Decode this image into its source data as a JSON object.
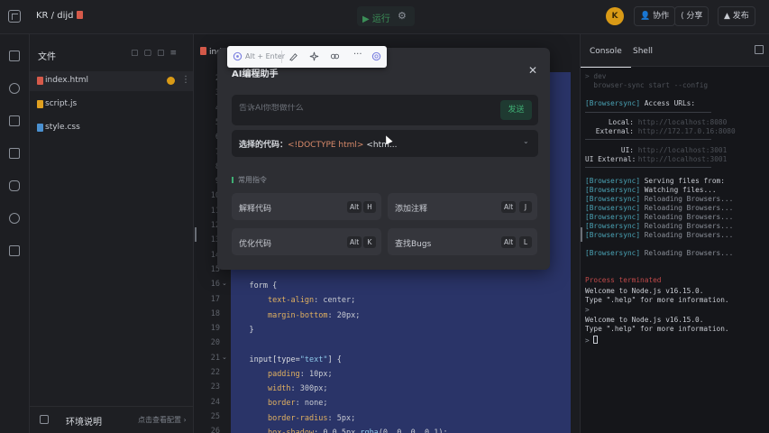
{
  "topbar": {
    "breadcrumb": "KR / dijd",
    "run_label": "▶ 运行",
    "avatar_initial": "K",
    "collab_label": "协作",
    "share_label": "分享",
    "publish_label": "发布"
  },
  "files": {
    "title": "文件",
    "items": [
      {
        "name": "index.html",
        "color": "#d65a4a"
      },
      {
        "name": "script.js",
        "color": "#e0a020"
      },
      {
        "name": "style.css",
        "color": "#4a90d0"
      }
    ],
    "footer_label": "环境说明",
    "footer_hint": "点击查看配置"
  },
  "editor": {
    "tab_label": "index.html",
    "line_numbers": [
      "2",
      "3",
      "4",
      "5",
      "6",
      "7",
      "8",
      "9",
      "10",
      "11",
      "12",
      "13",
      "14",
      "15",
      "16",
      "17",
      "18",
      "19",
      "20",
      "21",
      "22",
      "23",
      "24",
      "25",
      "26"
    ],
    "code_lines": [
      {
        "indent": "    ",
        "parts": [
          {
            "t": "form {",
            "c": "t-sel"
          }
        ]
      },
      {
        "indent": "        ",
        "parts": [
          {
            "t": "text-align",
            "c": "t-prop"
          },
          {
            "t": ": center;",
            "c": "t-fn"
          }
        ]
      },
      {
        "indent": "        ",
        "parts": [
          {
            "t": "margin-bottom",
            "c": "t-prop"
          },
          {
            "t": ": 20px;",
            "c": "t-fn"
          }
        ]
      },
      {
        "indent": "    ",
        "parts": [
          {
            "t": "}",
            "c": "t-sel"
          }
        ]
      },
      {
        "indent": "",
        "parts": [
          {
            "t": "",
            "c": "t-sel"
          }
        ]
      },
      {
        "indent": "    ",
        "parts": [
          {
            "t": "input[type=",
            "c": "t-sel"
          },
          {
            "t": "\"text\"",
            "c": "t-str"
          },
          {
            "t": "] {",
            "c": "t-sel"
          }
        ]
      },
      {
        "indent": "        ",
        "parts": [
          {
            "t": "padding",
            "c": "t-prop"
          },
          {
            "t": ": 10px;",
            "c": "t-fn"
          }
        ]
      },
      {
        "indent": "        ",
        "parts": [
          {
            "t": "width",
            "c": "t-prop"
          },
          {
            "t": ": 300px;",
            "c": "t-fn"
          }
        ]
      },
      {
        "indent": "        ",
        "parts": [
          {
            "t": "border",
            "c": "t-prop"
          },
          {
            "t": ": none;",
            "c": "t-fn"
          }
        ]
      },
      {
        "indent": "        ",
        "parts": [
          {
            "t": "border-radius",
            "c": "t-prop"
          },
          {
            "t": ": 5px;",
            "c": "t-fn"
          }
        ]
      },
      {
        "indent": "        ",
        "parts": [
          {
            "t": "box-shadow",
            "c": "t-prop"
          },
          {
            "t": ": 0 0 5px ",
            "c": "t-fn"
          },
          {
            "t": "rgba",
            "c": "t-str"
          },
          {
            "t": "(0, 0, 0, 0.1);",
            "c": "t-fn"
          }
        ]
      }
    ]
  },
  "console": {
    "tabs": [
      "Console",
      "Shell"
    ],
    "local_label": "Local:",
    "local_url": "http://localhost:8080",
    "external_label": "External:",
    "external_url": "http://172.17.0.16:8080",
    "ui_label": "UI:",
    "ui_url": "http://localhost:3001",
    "ui_external_label": "UI External:",
    "ui_external_url": "http://localhost:3001",
    "access_urls": "Access URLs:",
    "bs_tag": "[Browsersync]",
    "serving": "Serving files from:",
    "watching": "Watching files...",
    "reloading": "Reloading Browsers...",
    "welcome": "Welcome to Node.js v16.15.0.",
    "help": "Type \".help\" for more information.",
    "prompt": ">"
  },
  "modal": {
    "title": "AI编程助手",
    "placeholder": "告诉AI你想做什么",
    "send_label": "发送",
    "selected_label": "选择的代码：",
    "selected_tag": "<!DOCTYPE html>",
    "selected_rest": " <htm...",
    "section_title": "常用指令",
    "commands": [
      {
        "label": "解释代码",
        "keys": [
          "Alt",
          "H"
        ]
      },
      {
        "label": "添加注释",
        "keys": [
          "Alt",
          "J"
        ]
      },
      {
        "label": "优化代码",
        "keys": [
          "Alt",
          "K"
        ]
      },
      {
        "label": "查找Bugs",
        "keys": [
          "Alt",
          "L"
        ]
      }
    ]
  },
  "float_toolbar": {
    "shortcut": "Alt + Enter",
    "more": "···"
  },
  "colors": {
    "accent_green": "#3fae74",
    "editor_selection": "#2a3468",
    "avatar": "#d99a16"
  }
}
